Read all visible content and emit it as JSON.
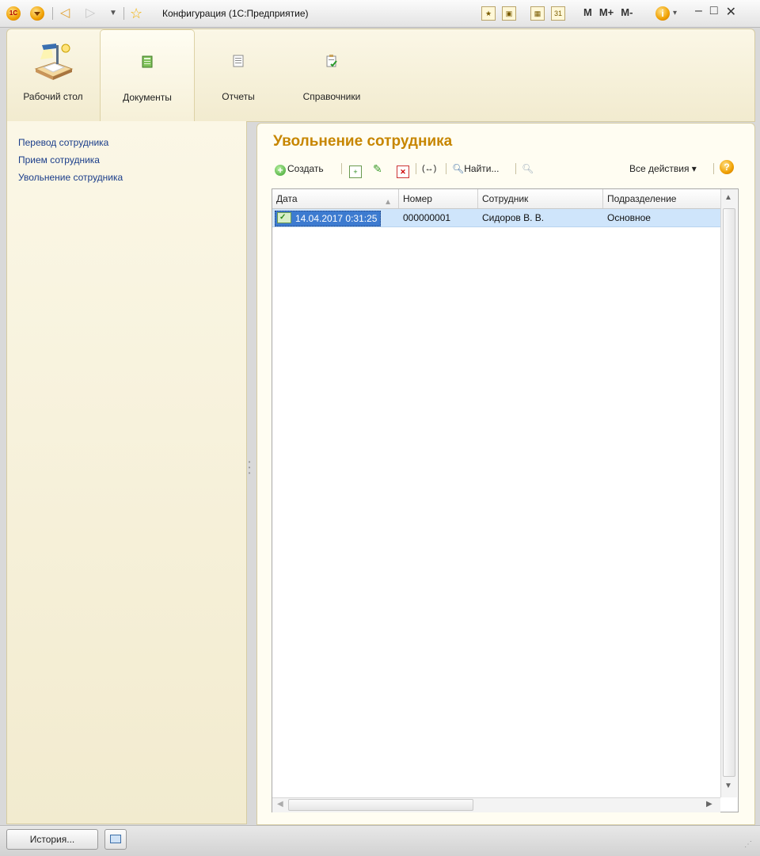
{
  "window": {
    "title": "Конфигурация  (1С:Предприятие)",
    "logo_text": "1С",
    "memory_buttons": [
      "M",
      "M+",
      "M-"
    ],
    "info_icon": "i",
    "controls": {
      "minimize": "–",
      "maximize": "□",
      "close": "✕"
    }
  },
  "sections": [
    {
      "label": "Рабочий стол",
      "icon": "desk-lamp-icon"
    },
    {
      "label": "Документы",
      "icon": "documents-icon",
      "active": true
    },
    {
      "label": "Отчеты",
      "icon": "report-icon"
    },
    {
      "label": "Справочники",
      "icon": "catalog-icon"
    }
  ],
  "nav": {
    "items": [
      "Перевод сотрудника",
      "Прием сотрудника",
      "Увольнение сотрудника"
    ]
  },
  "form": {
    "title": "Увольнение сотрудника",
    "toolbar": {
      "create_label": "Создать",
      "find_label": "Найти...",
      "all_actions_label": "Все действия ▾",
      "help_label": "?"
    },
    "table": {
      "columns": [
        "Дата",
        "Номер",
        "Сотрудник",
        "Подразделение"
      ],
      "rows": [
        {
          "date": "14.04.2017 0:31:25",
          "number": "000000001",
          "employee": "Сидоров В. В.",
          "department": "Основное"
        }
      ]
    }
  },
  "bottom": {
    "history_label": "История..."
  },
  "colors": {
    "accent_title": "#c78600",
    "panel_bg": "#f2ebcf",
    "selection": "#3d7bd0",
    "row_highlight": "#cfe5fb",
    "nav_link": "#1a3d8a"
  }
}
